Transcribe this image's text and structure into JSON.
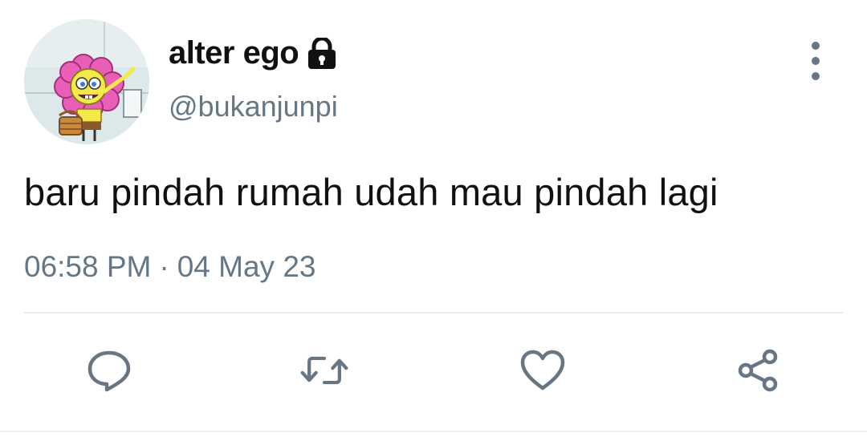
{
  "user": {
    "display_name": "alter ego",
    "handle": "@bukanjunpi",
    "protected": true
  },
  "tweet": {
    "text": "baru pindah rumah udah mau pindah lagi",
    "time": "06:58 PM",
    "separator": "·",
    "date": "04 May 23"
  },
  "icons": {
    "avatar": "spongebob-flower-avatar",
    "lock": "lock-icon",
    "more": "vertical-dots-icon",
    "reply": "reply-bubble-icon",
    "retweet": "retweet-icon",
    "like": "heart-icon",
    "share": "share-icon"
  },
  "colors": {
    "text_primary": "#111111",
    "text_secondary": "#657786",
    "icon_gray": "#687684",
    "divider": "#e6ecf0"
  }
}
